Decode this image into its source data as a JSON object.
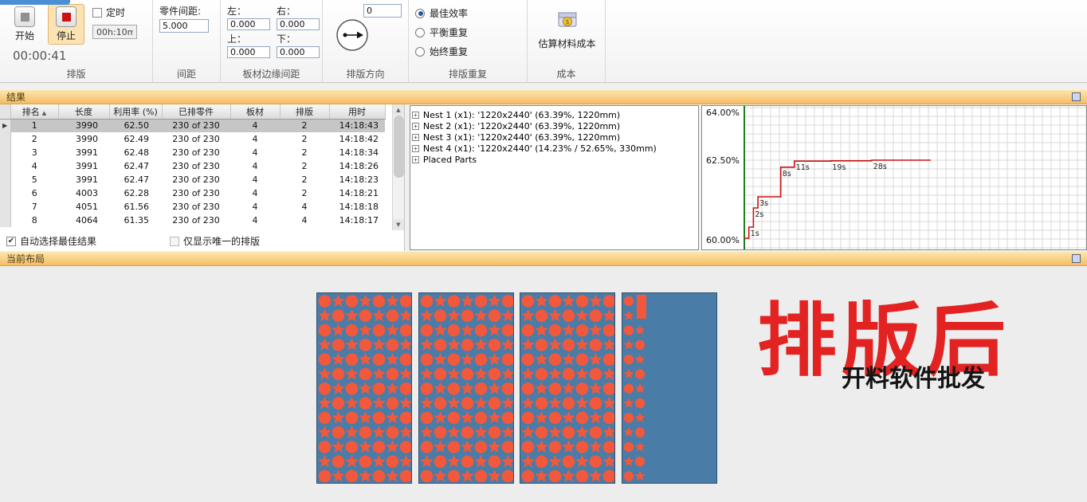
{
  "ribbon": {
    "start_label": "开始",
    "stop_label": "停止",
    "timer": {
      "label": "定时",
      "value": "00h:10m",
      "checked": false
    },
    "elapsed": "00:00:41",
    "part_spacing": {
      "label": "零件间距:",
      "value": "5.000"
    },
    "edge": {
      "left_label": "左：",
      "right_label": "右：",
      "top_label": "上：",
      "bottom_label": "下：",
      "left": "0.000",
      "right": "0.000",
      "top": "0.000",
      "bottom": "0.000"
    },
    "direction_value": "0",
    "repeat": {
      "options": [
        "最佳效率",
        "平衡重复",
        "始终重复"
      ],
      "selected": 0
    },
    "cost_button_label": "估算材料成本",
    "groups": {
      "nest": "排版",
      "spacing": "间距",
      "edge": "板材边缘间距",
      "direction": "排版方向",
      "repeat": "排版重复",
      "cost": "成本"
    }
  },
  "results": {
    "header": "结果",
    "columns": [
      "排名",
      "长度",
      "利用率 (%)",
      "已排零件",
      "板材",
      "排版",
      "用时"
    ],
    "rows": [
      [
        "1",
        "3990",
        "62.50",
        "230 of 230",
        "4",
        "2",
        "14:18:43"
      ],
      [
        "2",
        "3990",
        "62.49",
        "230 of 230",
        "4",
        "2",
        "14:18:42"
      ],
      [
        "3",
        "3991",
        "62.48",
        "230 of 230",
        "4",
        "2",
        "14:18:34"
      ],
      [
        "4",
        "3991",
        "62.47",
        "230 of 230",
        "4",
        "2",
        "14:18:26"
      ],
      [
        "5",
        "3991",
        "62.47",
        "230 of 230",
        "4",
        "2",
        "14:18:23"
      ],
      [
        "6",
        "4003",
        "62.28",
        "230 of 230",
        "4",
        "2",
        "14:18:21"
      ],
      [
        "7",
        "4051",
        "61.56",
        "230 of 230",
        "4",
        "4",
        "14:18:18"
      ],
      [
        "8",
        "4064",
        "61.35",
        "230 of 230",
        "4",
        "4",
        "14:18:17"
      ]
    ],
    "selected_index": 0,
    "auto_select": {
      "label": "自动选择最佳结果",
      "checked": true
    },
    "unique_only": {
      "label": "仅显示唯一的排版",
      "checked": false
    }
  },
  "tree": {
    "items": [
      "Nest 1 (x1): '1220x2440' (63.39%, 1220mm)",
      "Nest 2 (x1): '1220x2440' (63.39%, 1220mm)",
      "Nest 3 (x1): '1220x2440' (63.39%, 1220mm)",
      "Nest 4 (x1): '1220x2440' (14.23% / 52.65%, 330mm)",
      "Placed Parts"
    ]
  },
  "chart_data": {
    "type": "line",
    "style": "step",
    "title": "",
    "xlabel": "",
    "ylabel": "",
    "x_seconds": [
      0,
      1,
      2,
      3,
      8,
      11,
      19,
      28,
      41
    ],
    "y_percent": [
      60.05,
      60.4,
      61.0,
      61.35,
      62.28,
      62.47,
      62.48,
      62.5,
      62.5
    ],
    "point_labels": [
      "",
      "1s",
      "2s",
      "3s",
      "8s",
      "11s",
      "19s",
      "28s",
      ""
    ],
    "yticks": [
      64,
      62.5,
      60
    ],
    "ytick_labels": [
      "64.00%",
      "62.50%",
      "60.00%"
    ],
    "ylim": [
      59.7,
      64.2
    ],
    "xlim": [
      0,
      75
    ],
    "grid": true,
    "legend": false,
    "line_color": "#cc1111",
    "baseline_color": "#1b7f1b"
  },
  "layout": {
    "header": "当前布局",
    "watermark": "排版后",
    "watermark_sub": "开料软件批发",
    "sheet_color": "#4a7ca8",
    "part_color": "#f2583c",
    "sheets": [
      {
        "label": "Nest 1",
        "fill": "full"
      },
      {
        "label": "Nest 2",
        "fill": "full"
      },
      {
        "label": "Nest 3",
        "fill": "full"
      },
      {
        "label": "Nest 4",
        "fill": "strip"
      }
    ]
  }
}
